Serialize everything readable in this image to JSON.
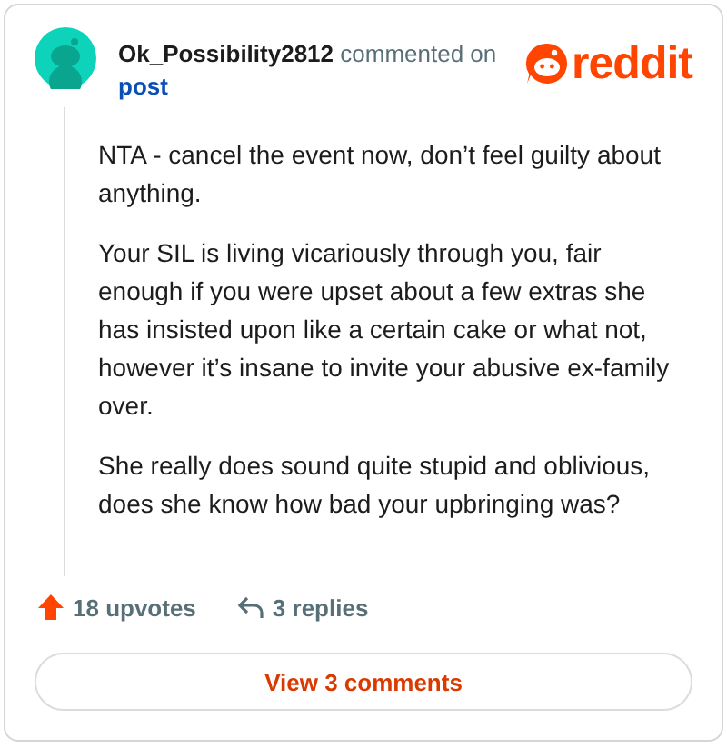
{
  "comment": {
    "author": "Ok_Possibility2812",
    "action": "commented on",
    "link": "post",
    "brand": "reddit",
    "paragraphs": [
      "NTA - cancel the event now, don’t feel guilty about anything.",
      "Your SIL is living vicariously through you, fair enough if you were upset about a few extras she has insisted upon like a certain cake or what not, however it’s insane to invite your abusive ex-family over.",
      "She really does sound quite stupid and oblivious, does she know how bad your upbringing was?"
    ],
    "upvotes": "18 upvotes",
    "replies": "3 replies"
  },
  "button": "View 3 comments"
}
